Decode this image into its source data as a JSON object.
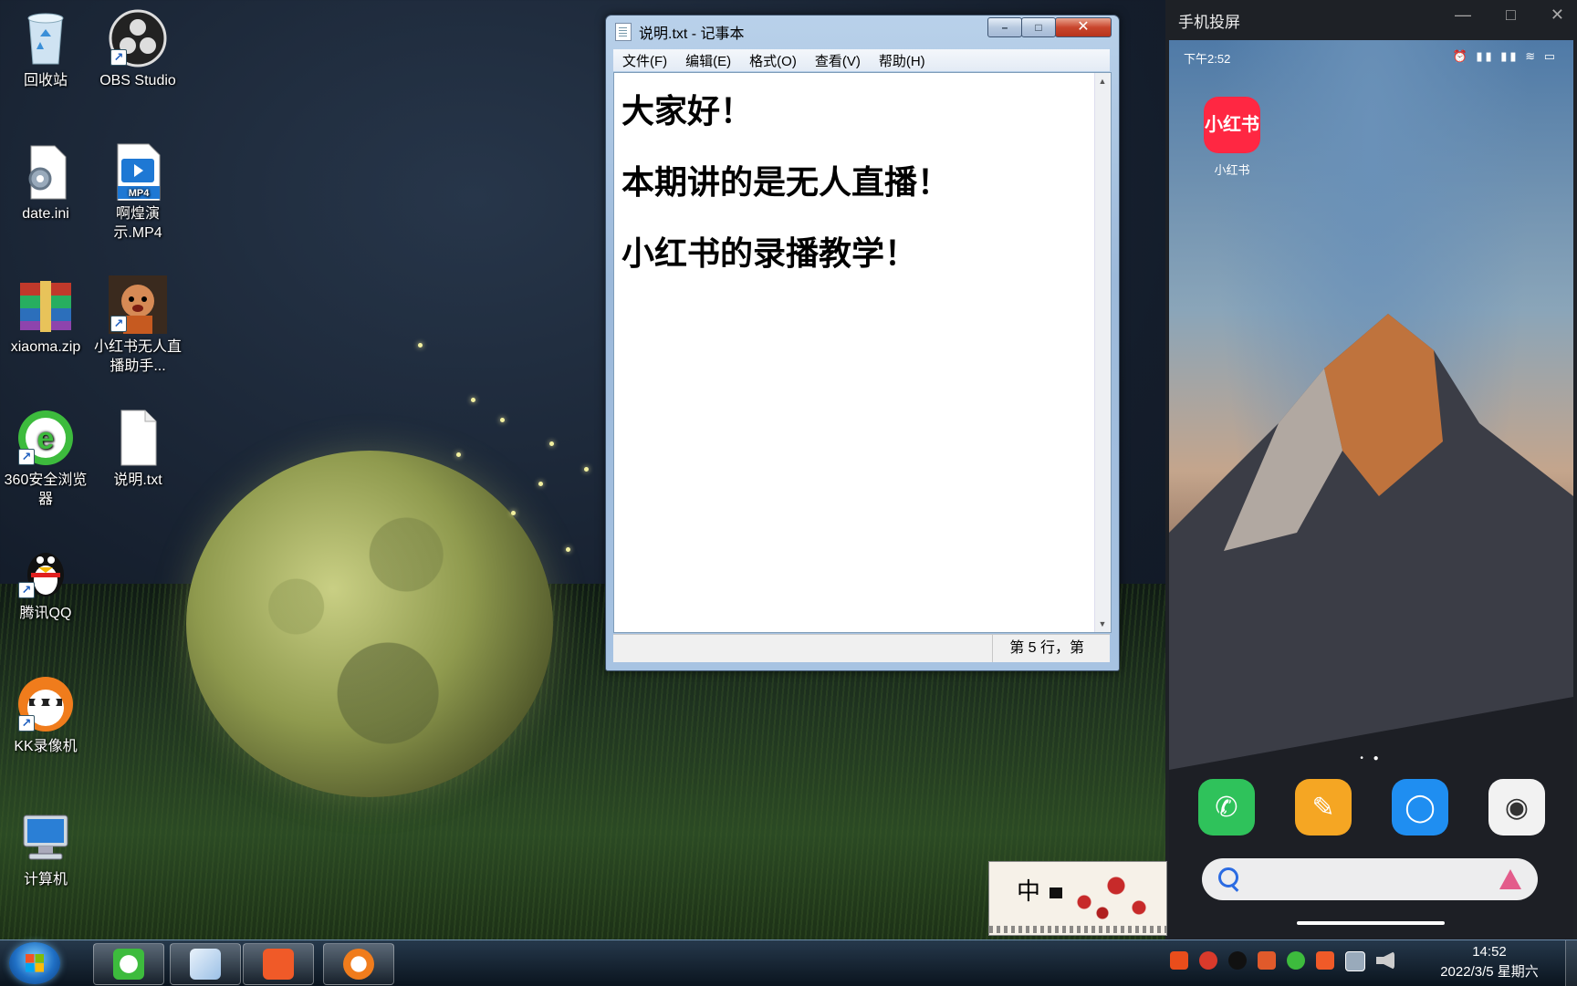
{
  "desktop": {
    "icons": [
      {
        "label": "回收站",
        "icon": "recycle-bin-icon"
      },
      {
        "label": "OBS Studio",
        "icon": "obs-icon"
      },
      {
        "label": "date.ini",
        "icon": "config-file-icon"
      },
      {
        "label": "啊煌演示.MP4",
        "icon": "mp4-file-icon"
      },
      {
        "label": "xiaoma.zip",
        "icon": "zip-archive-icon"
      },
      {
        "label": "小红书无人直播助手...",
        "icon": "app-avatar-icon"
      },
      {
        "label": "360安全浏览器",
        "icon": "360-browser-icon"
      },
      {
        "label": "说明.txt",
        "icon": "text-file-icon"
      },
      {
        "label": "腾讯QQ",
        "icon": "qq-penguin-icon"
      },
      {
        "label": "KK录像机",
        "icon": "kk-recorder-icon"
      },
      {
        "label": "计算机",
        "icon": "computer-icon"
      }
    ],
    "mp4_badge": "MP4"
  },
  "notepad": {
    "title": "说明.txt - 记事本",
    "menu": [
      "文件(F)",
      "编辑(E)",
      "格式(O)",
      "查看(V)",
      "帮助(H)"
    ],
    "lines": [
      "大家好！",
      "本期讲的是无人直播！",
      "小红书的录播教学！"
    ],
    "status": "第 5 行，第"
  },
  "phone": {
    "window_title": "手机投屏",
    "status_time": "下午2:52",
    "app_label": "小红书",
    "app_icon_text": "小红书",
    "dock": [
      "phone-icon",
      "notes-icon",
      "messages-icon",
      "camera-icon"
    ]
  },
  "ime": {
    "mode": "中"
  },
  "taskbar": {
    "time": "14:52",
    "date": "2022/3/5 星期六"
  },
  "colors": {
    "xhs_red": "#ff2742",
    "notepad_close": "#c9462d"
  }
}
